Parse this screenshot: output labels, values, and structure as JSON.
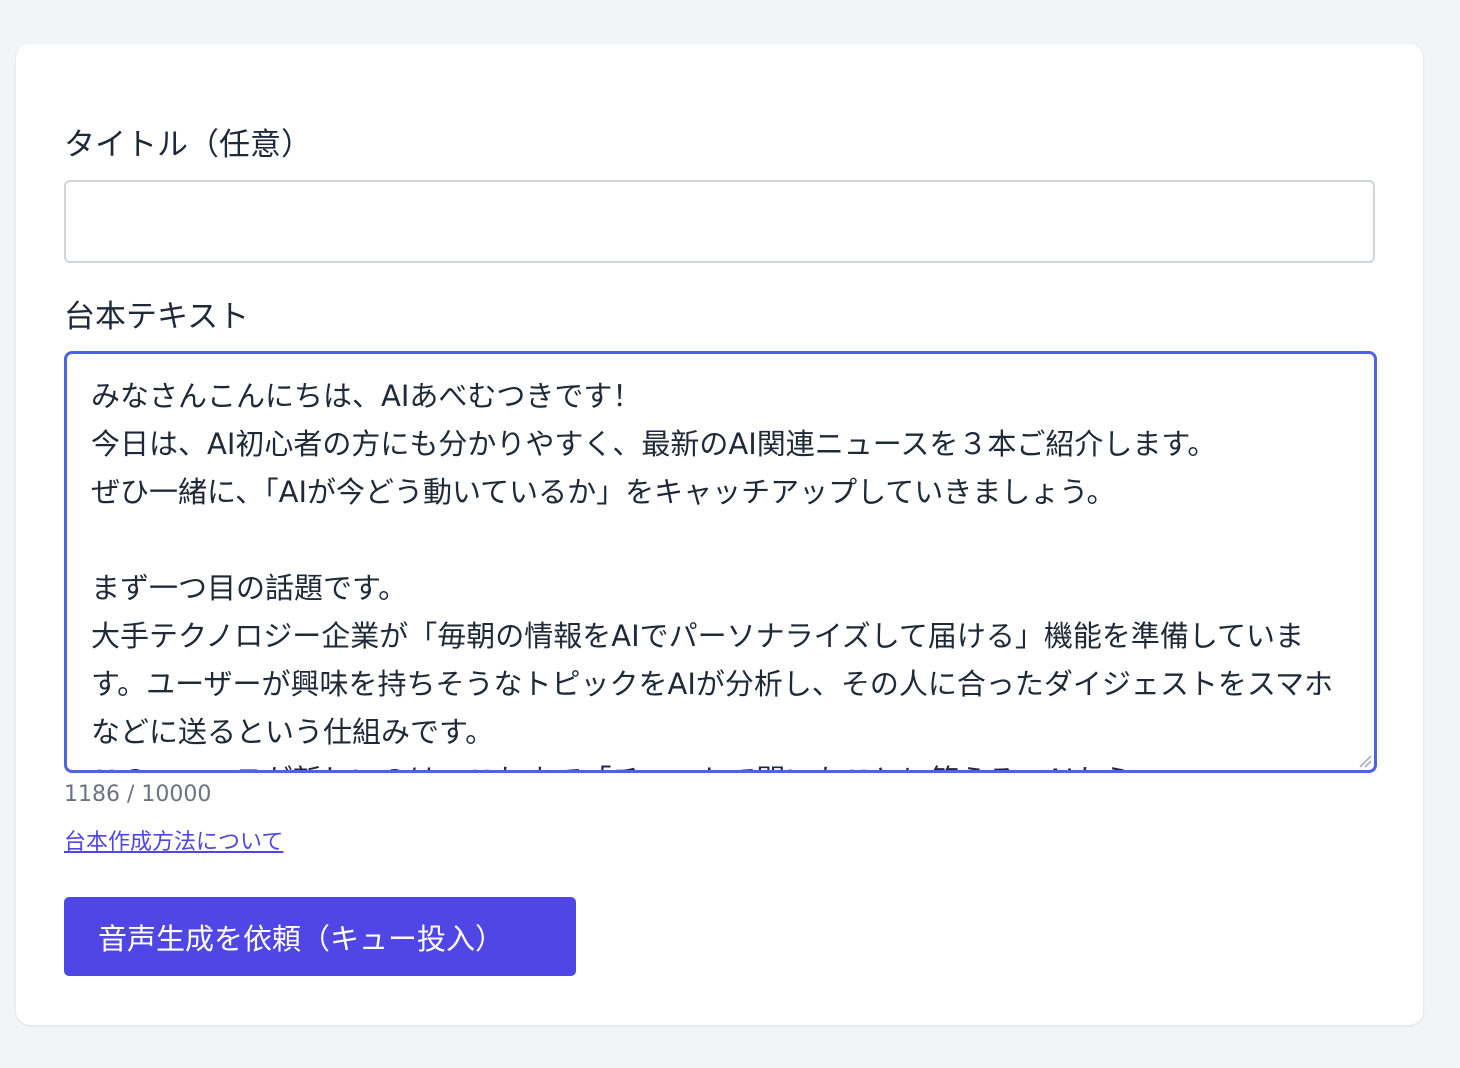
{
  "form": {
    "title_label": "タイトル（任意）",
    "title_value": "",
    "script_label": "台本テキスト",
    "script_text": "みなさんこんにちは、AIあべむつきです！\n今日は、AI初心者の方にも分かりやすく、最新のAI関連ニュースを３本ご紹介します。\nぜひ一緒に、「AIが今どう動いているか」をキャッチアップしていきましょう。\n\nまず一つ目の話題です。\n大手テクノロジー企業が「毎朝の情報をAIでパーソナライズして届ける」機能を準備しています。ユーザーが興味を持ちそうなトピックをAIが分析し、その人に合ったダイジェストをスマホなどに送るという仕組みです。\nこのニュースが新しいのは、これまで「チャットで聞いたことに答える」AIから、ユ",
    "char_count": "1186 / 10000",
    "help_link": "台本作成方法について",
    "submit_label": "音声生成を依頼（キュー投入）"
  }
}
